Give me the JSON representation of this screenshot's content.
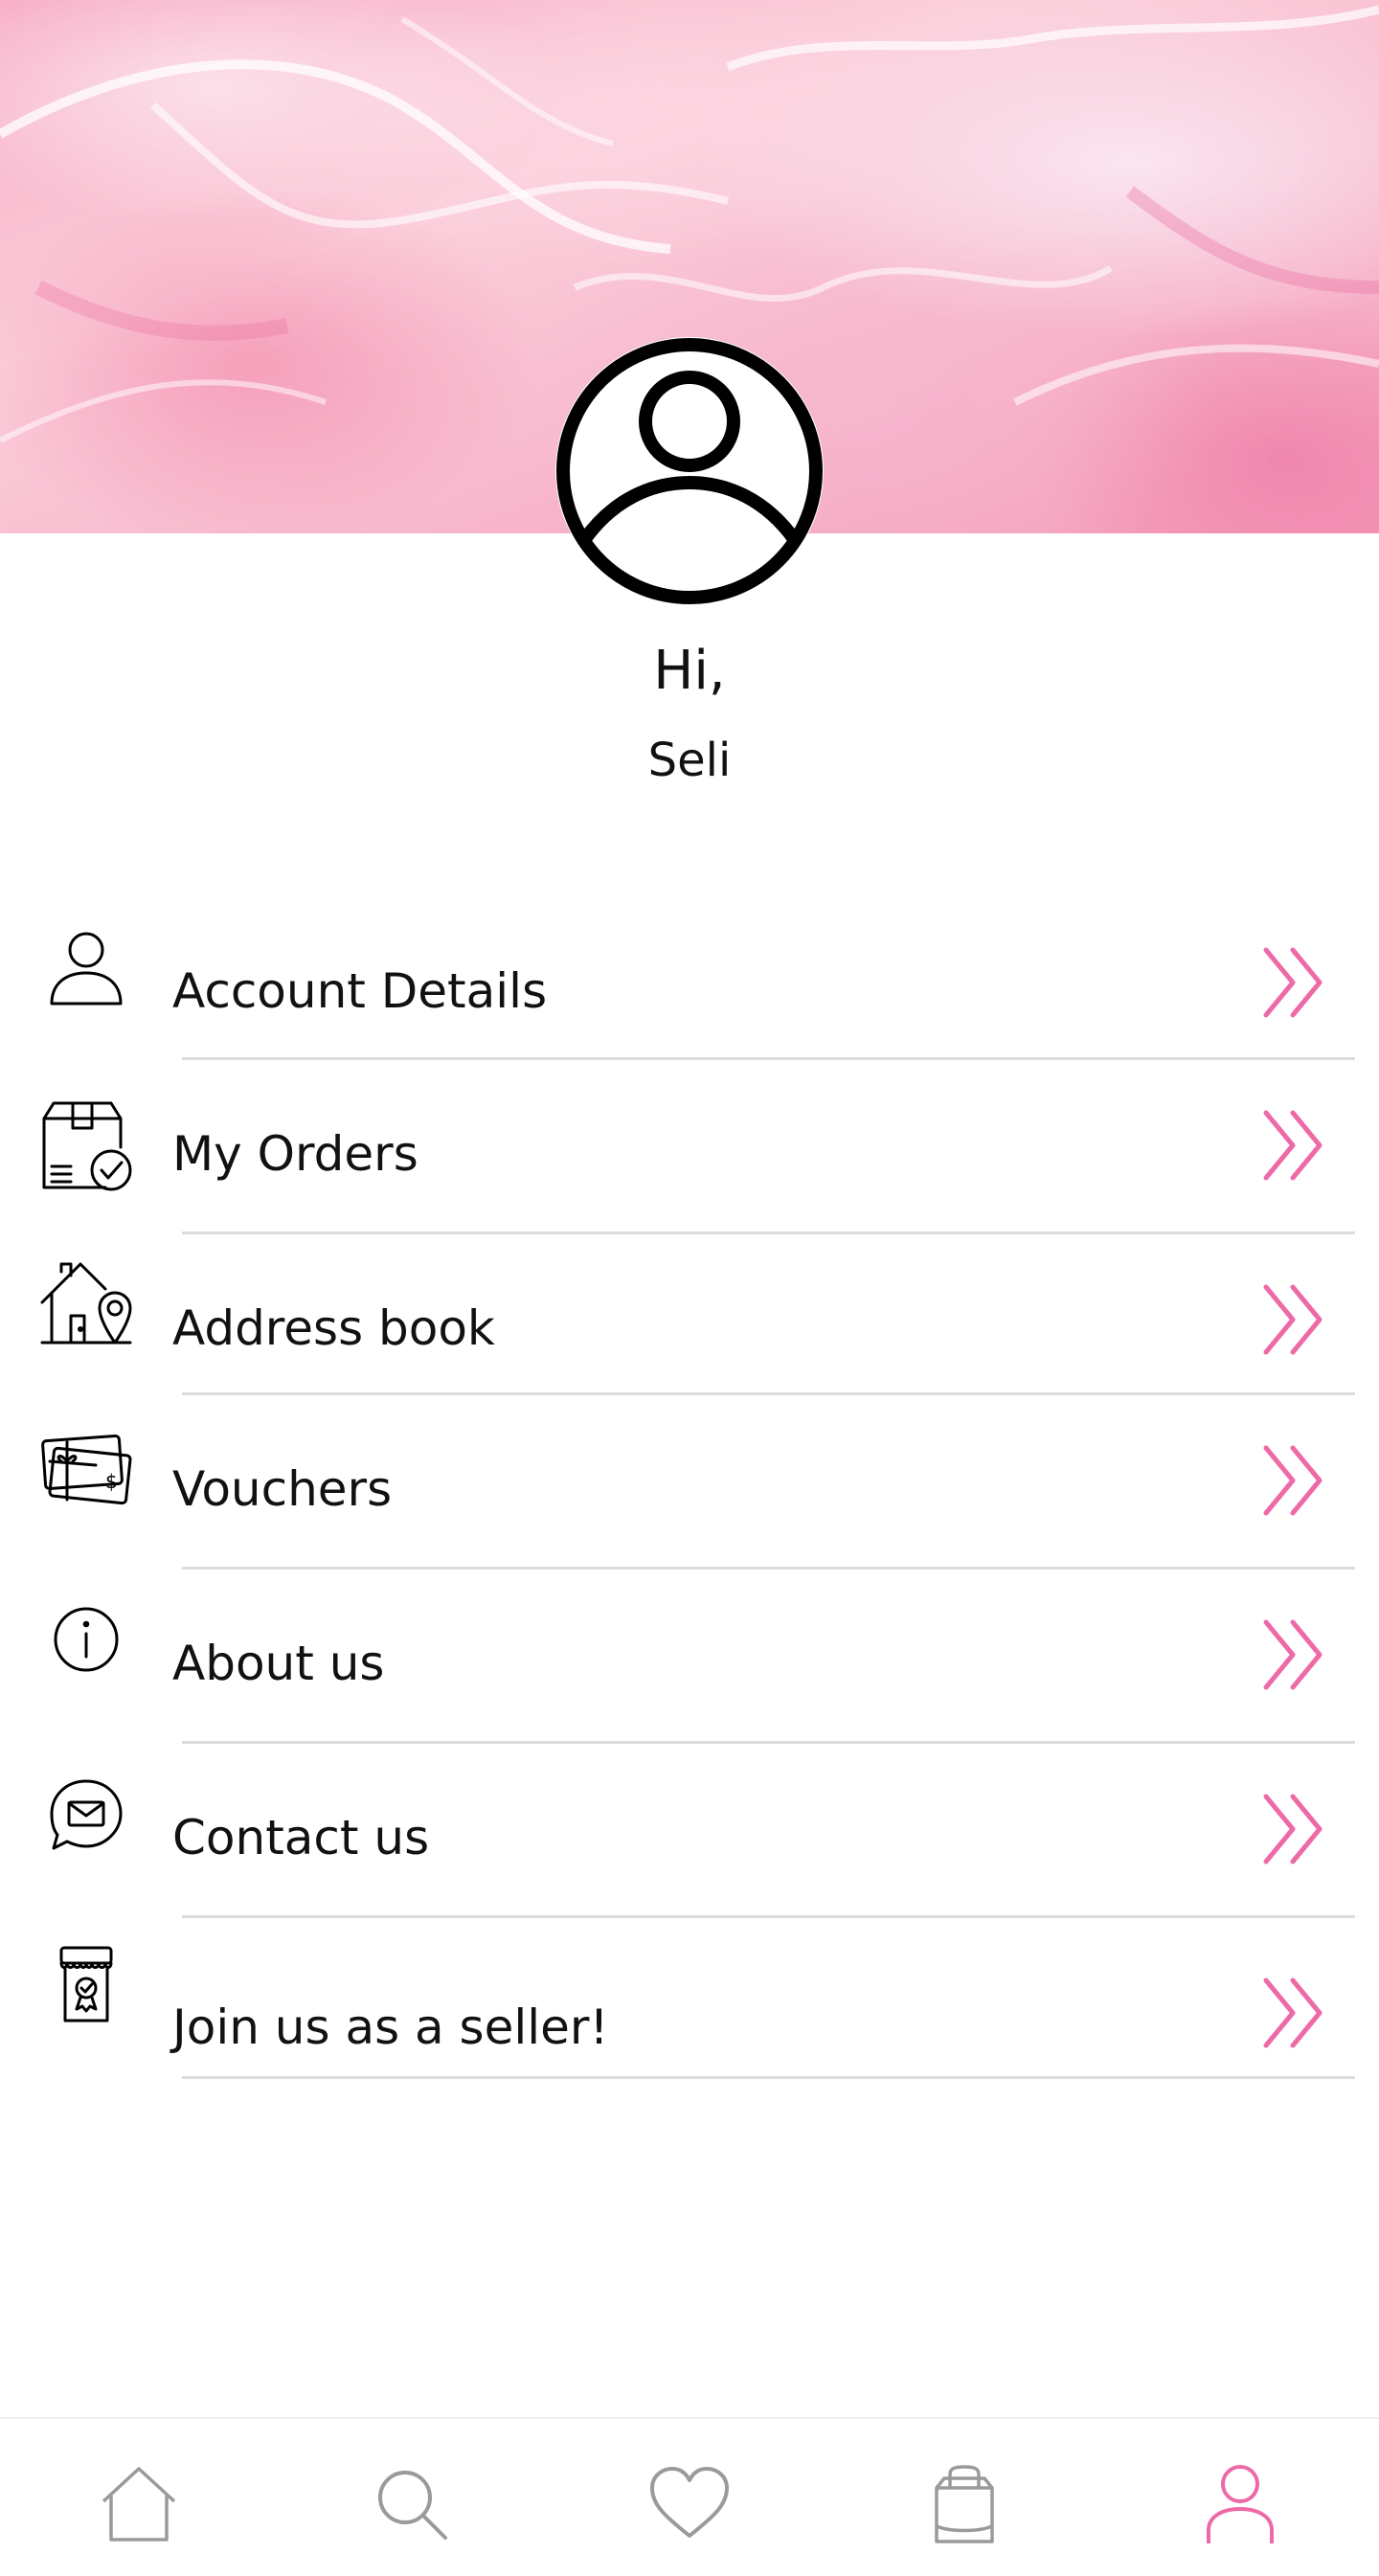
{
  "profile": {
    "greeting": "Hi,",
    "name": "Seli"
  },
  "menu": {
    "items": [
      {
        "label": "Account Details",
        "icon": "user-icon"
      },
      {
        "label": "My Orders",
        "icon": "order-box-check-icon"
      },
      {
        "label": "Address book",
        "icon": "house-location-icon"
      },
      {
        "label": "Vouchers",
        "icon": "gift-voucher-icon"
      },
      {
        "label": "About us",
        "icon": "info-icon"
      },
      {
        "label": "Contact us",
        "icon": "mail-chat-icon"
      },
      {
        "label": "Join us as a seller!",
        "icon": "seller-shop-icon"
      }
    ],
    "chevron_icon": "double-chevron-right-icon"
  },
  "bottom_nav": {
    "items": [
      {
        "icon": "home-icon",
        "active": false
      },
      {
        "icon": "search-icon",
        "active": false
      },
      {
        "icon": "heart-icon",
        "active": false
      },
      {
        "icon": "shopping-bag-icon",
        "active": false
      },
      {
        "icon": "profile-icon",
        "active": true
      }
    ]
  },
  "colors": {
    "accent": "#ee6aa7",
    "text": "#111111",
    "inactive_icon": "#9a9a9a",
    "divider": "#dcdcdc",
    "banner": "#f7b3c8"
  }
}
